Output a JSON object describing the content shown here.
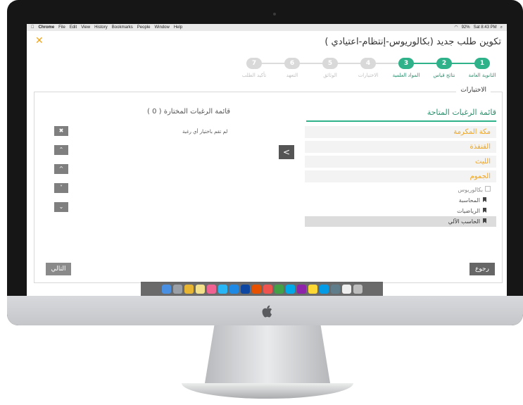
{
  "menubar": {
    "app": "Chrome",
    "items": [
      "File",
      "Edit",
      "View",
      "History",
      "Bookmarks",
      "People",
      "Window",
      "Help"
    ],
    "status_battery": "92%",
    "clock": "Sat 8:43 PM"
  },
  "page": {
    "title": "تكوين طلب جديد (بكالوريوس-إنتظام-اعتيادي )",
    "close_symbol": "✕"
  },
  "steps": [
    {
      "num": "1",
      "label": "الثانوية العامة",
      "state": "done"
    },
    {
      "num": "2",
      "label": "نتائج قياس",
      "state": "done"
    },
    {
      "num": "3",
      "label": "المواد العلمية",
      "state": "done"
    },
    {
      "num": "4",
      "label": "الاختيارات",
      "state": "todo"
    },
    {
      "num": "5",
      "label": "الوثائق",
      "state": "todo"
    },
    {
      "num": "6",
      "label": "التعهد",
      "state": "todo"
    },
    {
      "num": "7",
      "label": "تأكيد الطلب",
      "state": "todo"
    }
  ],
  "panel": {
    "legend": "الاختيارات",
    "available_title": "قائمة الرغبات المتاحة",
    "chosen_title": "قائمة الرغبات المختارة ( 0 )",
    "empty_message": "لم تقم باختيار أي رغبة",
    "cities": [
      "مكة المكرمة",
      "القنفذة",
      "الليث",
      "الجموم"
    ],
    "program": "بكالوريوس",
    "majors": [
      "المحاسبة",
      "الرياضيات",
      "الحاسب الآلي"
    ],
    "move_symbol": "<",
    "controls": [
      "✖",
      "⌃",
      "^",
      "˅",
      "⌄"
    ],
    "next_label": "التالي",
    "back_label": "رجوع"
  },
  "colors": {
    "accent": "#2fb28a",
    "orange": "#f0a51e",
    "muted": "#d9d9d9"
  }
}
